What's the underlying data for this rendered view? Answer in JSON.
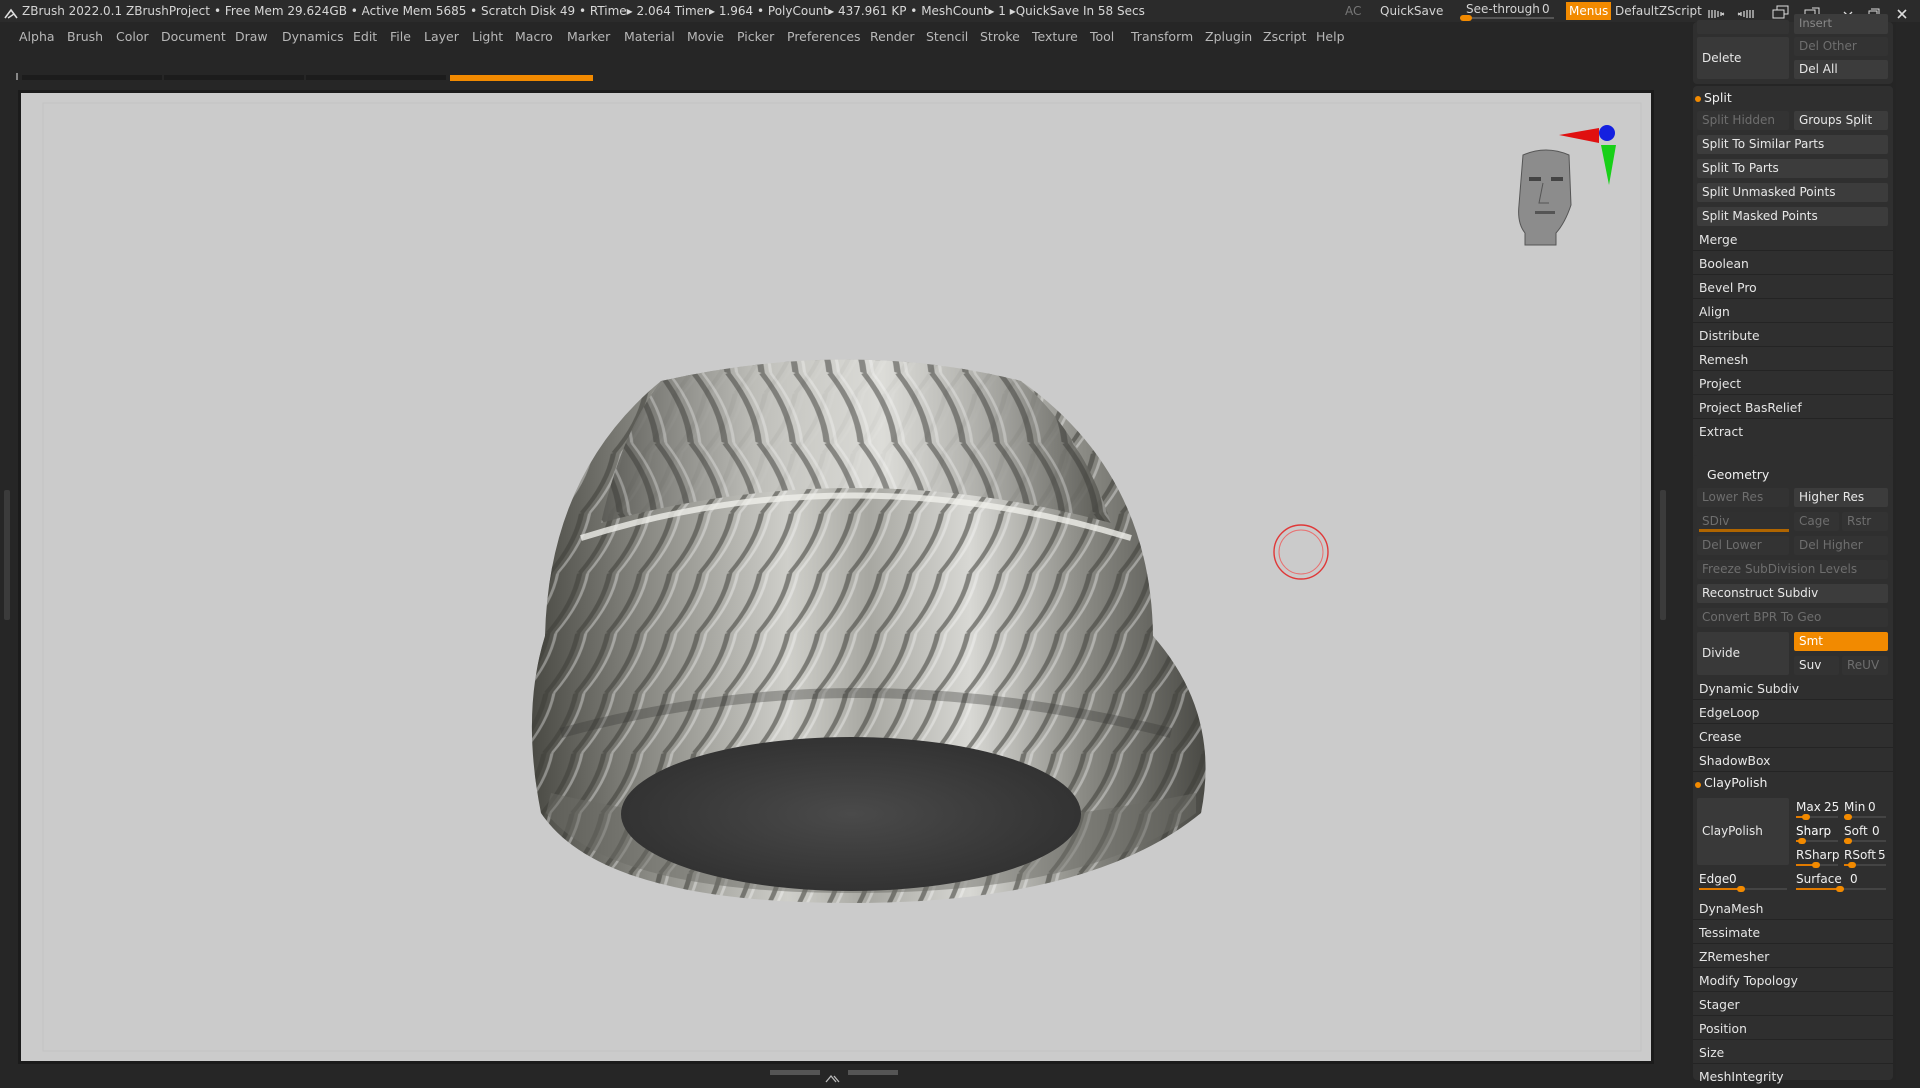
{
  "titlebar": {
    "app": "ZBrush 2022.0.1",
    "project": "ZBrushProject",
    "stats": "• Free Mem 29.624GB • Active Mem 5685 • Scratch Disk 49 •  RTime▸ 2.064 Timer▸ 1.964 • PolyCount▸ 437.961 KP  • MeshCount▸ 1  ▸QuickSave In 58 Secs",
    "ac": "AC",
    "quicksave": "QuickSave",
    "seethrough": "See-through",
    "seethrough_value": "0",
    "menus": "Menus",
    "defaultzscript": "DefaultZScript"
  },
  "menu": [
    "Alpha",
    "Brush",
    "Color",
    "Document",
    "Draw",
    "Dynamics",
    "Edit",
    "File",
    "Layer",
    "Light",
    "Macro",
    "Marker",
    "Material",
    "Movie",
    "Picker",
    "Preferences",
    "Render",
    "Stencil",
    "Stroke",
    "Texture",
    "Tool",
    "Transform",
    "Zplugin",
    "Zscript",
    "Help"
  ],
  "panel": {
    "insert": "Insert",
    "delete": "Delete",
    "del_other": "Del Other",
    "del_all": "Del All",
    "split": "Split",
    "split_hidden": "Split Hidden",
    "groups_split": "Groups Split",
    "split_similar": "Split To Similar Parts",
    "split_parts": "Split To Parts",
    "split_unmasked": "Split Unmasked Points",
    "split_masked": "Split Masked Points",
    "merge": "Merge",
    "boolean": "Boolean",
    "bevel_pro": "Bevel Pro",
    "align": "Align",
    "distribute": "Distribute",
    "remesh": "Remesh",
    "project": "Project",
    "project_basrelief": "Project BasRelief",
    "extract": "Extract",
    "geometry": "Geometry",
    "lower_res": "Lower Res",
    "higher_res": "Higher Res",
    "sdiv": "SDiv",
    "cage": "Cage",
    "rstr": "Rstr",
    "del_lower": "Del Lower",
    "del_higher": "Del Higher",
    "freeze_subdiv": "Freeze SubDivision Levels",
    "reconstruct_subdiv": "Reconstruct Subdiv",
    "convert_bpr": "Convert BPR To Geo",
    "divide": "Divide",
    "smt": "Smt",
    "suv": "Suv",
    "reuv": "ReUV",
    "dynamic_subdiv": "Dynamic Subdiv",
    "edgeloop": "EdgeLoop",
    "crease": "Crease",
    "shadowbox": "ShadowBox",
    "claypolish_header": "ClayPolish",
    "claypolish_btn": "ClayPolish",
    "max_label": "Max",
    "max_value": "25",
    "min_label": "Min",
    "min_value": "0",
    "sharp_label": "Sharp",
    "soft_label": "Soft",
    "soft_value": "0",
    "rsharp_label": "RSharp",
    "rsoft_label": "RSoft",
    "rsoft_value": "5",
    "edge_label": "Edge",
    "edge_value": "0",
    "surface_label": "Surface",
    "surface_value": "0",
    "dynamesh": "DynaMesh",
    "tessimate": "Tessimate",
    "zremesher": "ZRemesher",
    "modify_topology": "Modify Topology",
    "stager": "Stager",
    "position": "Position",
    "size": "Size",
    "meshintegrity": "MeshIntegrity"
  },
  "colors": {
    "accent": "#f28a00",
    "viewport_bg": "#cbcbcb",
    "panel_bg": "#2f2f2f"
  }
}
